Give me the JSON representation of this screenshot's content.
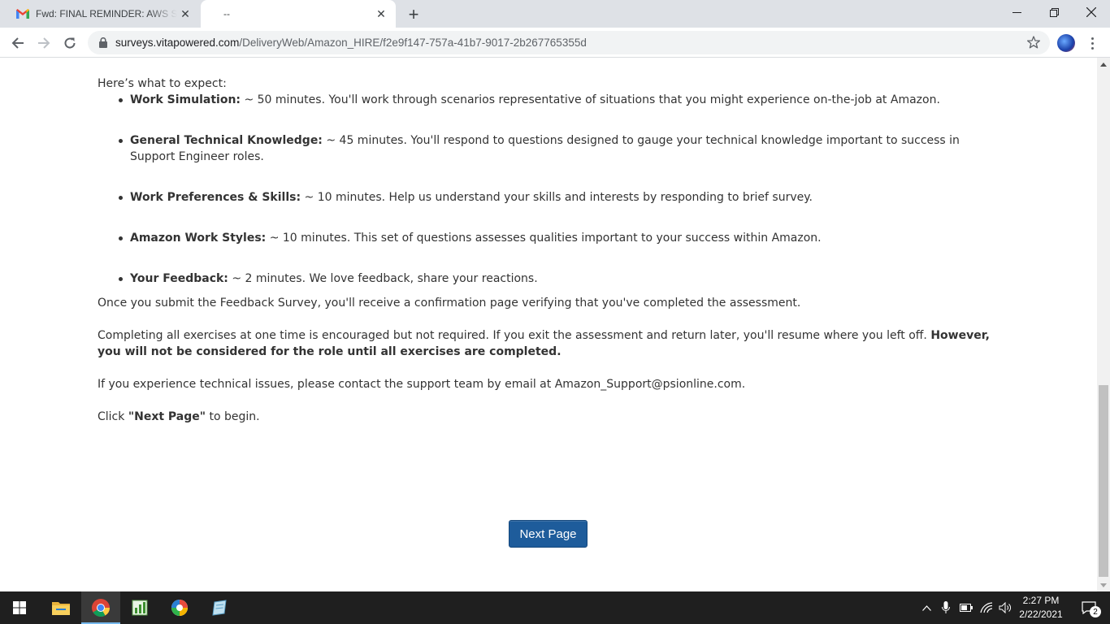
{
  "browser": {
    "tabs": [
      {
        "title": "Fwd: FINAL REMINDER: AWS Support",
        "favicon": "gmail-icon",
        "active": false
      },
      {
        "title": "--",
        "favicon": "",
        "active": true
      }
    ],
    "url_host": "surveys.vitapowered.com",
    "url_path": "/DeliveryWeb/Amazon_HIRE/f2e9f147-757a-41b7-9017-2b267765355d"
  },
  "page": {
    "intro": "Here’s what to expect:",
    "items": [
      {
        "label": "Work Simulation:",
        "text": " ~ 50 minutes. You'll work through scenarios representative of situations that you might experience on-the-job at Amazon."
      },
      {
        "label": "General Technical Knowledge:",
        "text": " ~ 45 minutes. You'll respond to questions designed to gauge your technical knowledge important to success in Support Engineer roles."
      },
      {
        "label": "Work Preferences & Skills:",
        "text": " ~ 10 minutes. Help us understand your skills and interests by responding to brief survey."
      },
      {
        "label": "Amazon Work Styles:",
        "text": " ~ 10 minutes. This set of questions assesses qualities important to your success within Amazon."
      },
      {
        "label": "Your Feedback:",
        "text": " ~ 2 minutes. We love feedback, share your reactions."
      }
    ],
    "submit_note": "Once you submit the Feedback Survey, you'll receive a confirmation page verifying that you've completed the assessment.",
    "completion_note": "Completing all exercises at one time is encouraged but not required. If you exit the assessment and return later, you'll resume where you left off. ",
    "completion_bold": "However, you will not be considered for the role until all exercises are completed.",
    "support_note": "If you experience technical issues, please contact the support team by email at Amazon_Support@psionline.com.",
    "click_prefix": "Click ",
    "click_bold": "\"Next Page\"",
    "click_suffix": " to begin.",
    "next_button": "Next Page"
  },
  "taskbar": {
    "time": "2:27 PM",
    "date": "2/22/2021",
    "notifications": "2"
  }
}
